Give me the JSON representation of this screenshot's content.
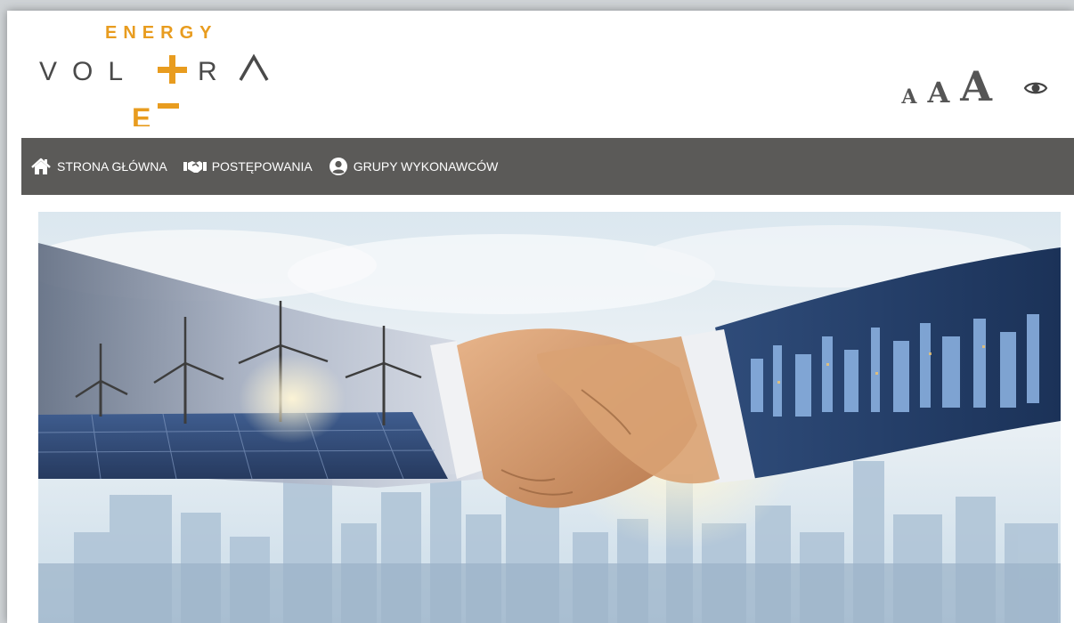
{
  "logo": {
    "top_text": "ENERGY",
    "main_text": "VOLTRA",
    "brand_color": "#e89c1f",
    "text_color": "#4a4a4a"
  },
  "accessibility": {
    "font_small": "A",
    "font_medium": "A",
    "font_large": "A",
    "contrast_icon": "eye-icon"
  },
  "nav": {
    "items": [
      {
        "label": "STRONA GŁÓWNA",
        "icon": "home-icon"
      },
      {
        "label": "POSTĘPOWANIA",
        "icon": "handshake-icon"
      },
      {
        "label": "GRUPY WYKONAWCÓW",
        "icon": "user-circle-icon"
      }
    ],
    "background": "#5b5a58"
  },
  "hero": {
    "image": "handshake-renewable-energy-city-banner"
  }
}
